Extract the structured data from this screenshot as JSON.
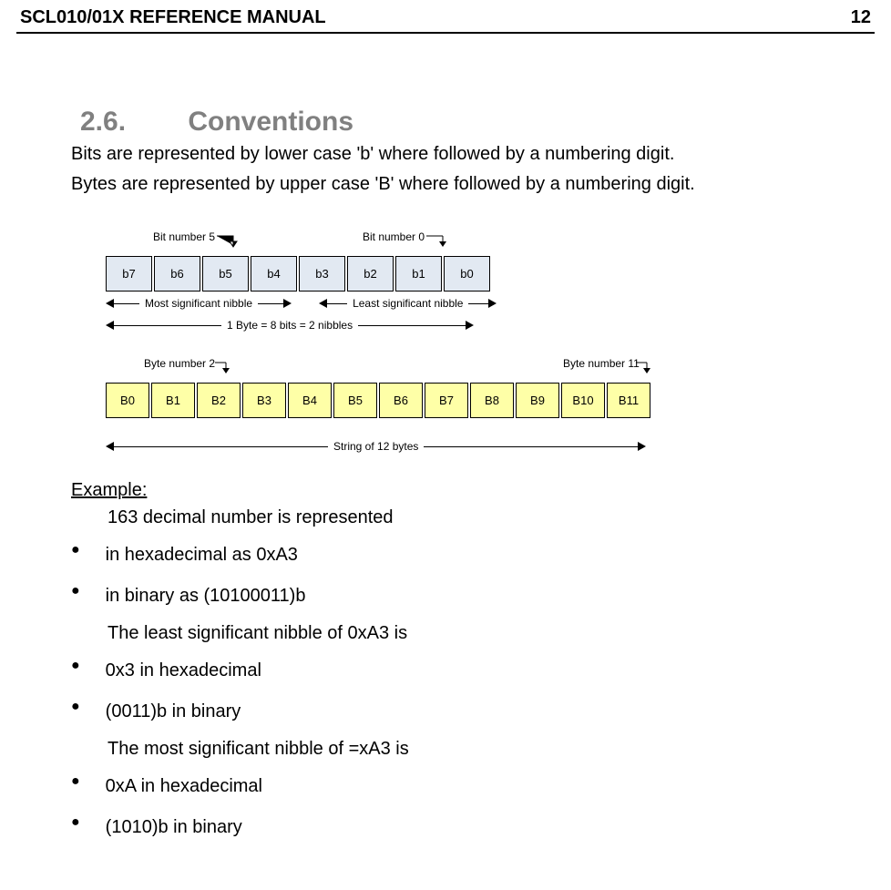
{
  "header": {
    "title": "SCL010/01X REFERENCE MANUAL",
    "page": "12"
  },
  "section": {
    "number": "2.6.",
    "title": "Conventions"
  },
  "intro": {
    "line1": "Bits are represented by lower case 'b' where followed by a numbering digit.",
    "line2": "Bytes are represented by upper case 'B' where followed by a numbering digit."
  },
  "diagram": {
    "bit5": "Bit number 5",
    "bit0": "Bit number 0",
    "bits": [
      "b7",
      "b6",
      "b5",
      "b4",
      "b3",
      "b2",
      "b1",
      "b0"
    ],
    "msn": "Most significant nibble",
    "lsn": "Least significant nibble",
    "byteLine": "1 Byte = 8 bits = 2 nibbles",
    "byte2": "Byte number 2",
    "byte11": "Byte number 11",
    "bytes": [
      "B0",
      "B1",
      "B2",
      "B3",
      "B4",
      "B5",
      "B6",
      "B7",
      "B8",
      "B9",
      "B10",
      "B11"
    ],
    "string": "String of 12 bytes"
  },
  "example": {
    "heading": "Example:",
    "line1": "163 decimal number is represented",
    "b1": "in hexadecimal as 0xA3",
    "b2": "in binary as (10100011)b",
    "line2": "The least significant nibble of 0xA3 is",
    "b3": "0x3 in hexadecimal",
    "b4": "(0011)b in binary",
    "line3": "The most significant nibble of =xA3 is",
    "b5": "0xA in hexadecimal",
    "b6": "(1010)b in binary"
  }
}
